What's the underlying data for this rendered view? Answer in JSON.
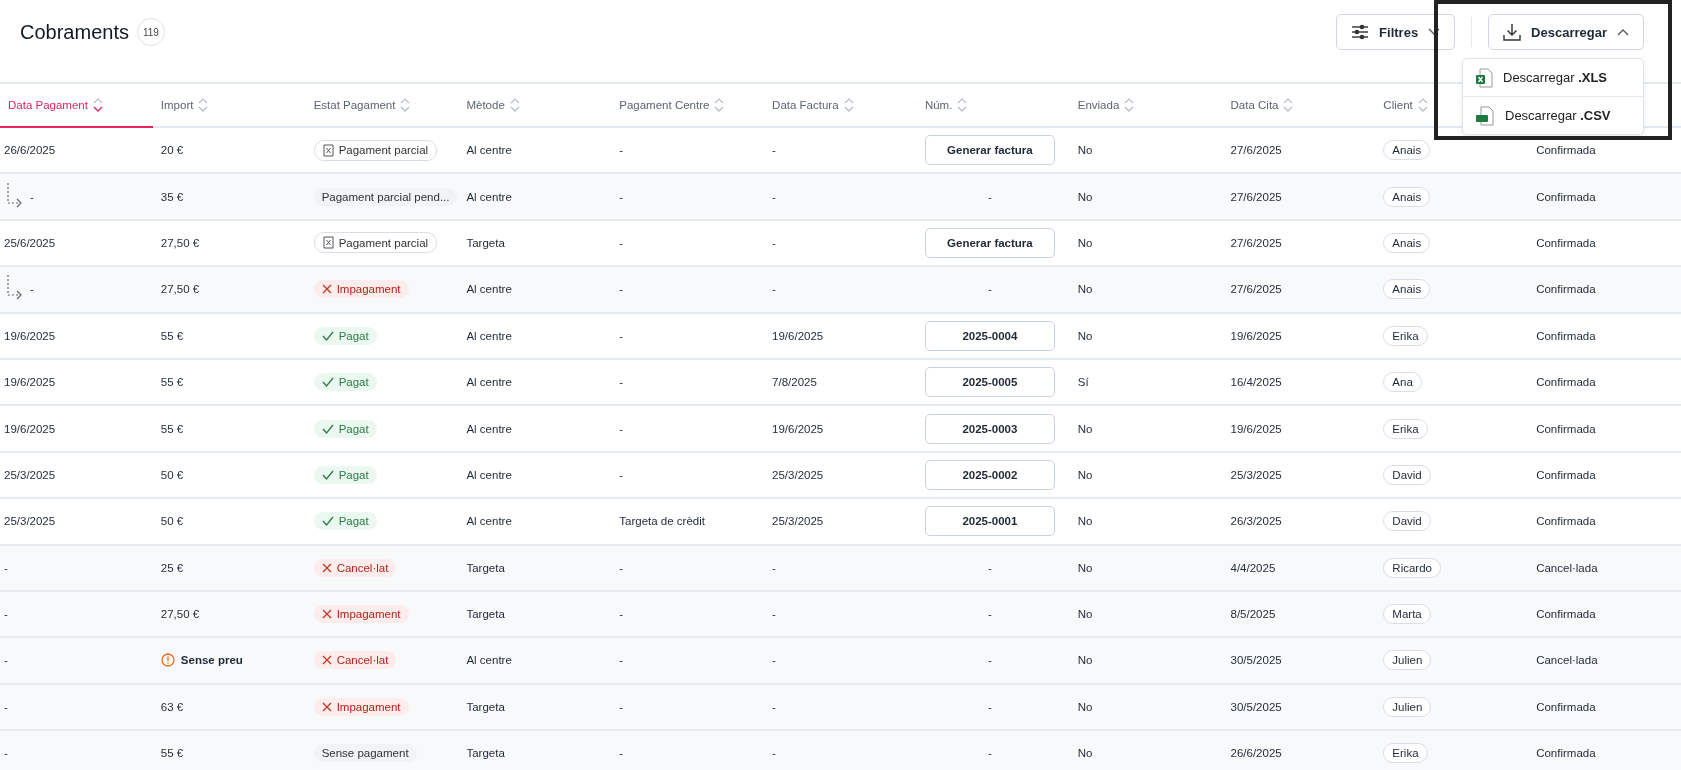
{
  "page": {
    "title": "Cobraments",
    "count": "119"
  },
  "toolbar": {
    "filters": {
      "label": "Filtres"
    },
    "download": {
      "label": "Descarregar",
      "expanded": true,
      "menu": [
        {
          "label": "Descarregar **.XLS**",
          "kind": "xls"
        },
        {
          "label": "Descarregar **.CSV**",
          "kind": "csv"
        }
      ]
    }
  },
  "table": {
    "columns": [
      {
        "label": "Data Pagament",
        "sorted": true
      },
      {
        "label": "Import",
        "sorted": false
      },
      {
        "label": "Estat Pagament",
        "sorted": false
      },
      {
        "label": "Mètode",
        "sorted": false
      },
      {
        "label": "Pagament Centre",
        "sorted": false
      },
      {
        "label": "Data Factura",
        "sorted": false
      },
      {
        "label": "Núm.",
        "sorted": false
      },
      {
        "label": "Enviada",
        "sorted": false
      },
      {
        "label": "Data Cita",
        "sorted": false
      },
      {
        "label": "Client",
        "sorted": false
      }
    ],
    "rows": [
      {
        "kind": "main",
        "date": "26/6/2025",
        "import": "20 €",
        "no_price": false,
        "status": {
          "label": "Pagament parcial",
          "kind": "partial"
        },
        "method": "Al centre",
        "centre": "-",
        "invoice_date": "-",
        "number": {
          "text": "Generar factura",
          "kind": "button"
        },
        "sent": "No",
        "appointment": "27/6/2025",
        "client": "Anais",
        "column_11": "Confirmada"
      },
      {
        "kind": "child",
        "date": "-",
        "import": "35 €",
        "no_price": false,
        "status": {
          "label": "Pagament parcial pend...",
          "kind": "plain"
        },
        "method": "Al centre",
        "centre": "-",
        "invoice_date": "-",
        "number": {
          "text": "-",
          "kind": "text"
        },
        "sent": "No",
        "appointment": "27/6/2025",
        "client": "Anais",
        "column_11": "Confirmada"
      },
      {
        "kind": "main",
        "date": "25/6/2025",
        "import": "27,50 €",
        "no_price": false,
        "status": {
          "label": "Pagament parcial",
          "kind": "partial"
        },
        "method": "Targeta",
        "centre": "-",
        "invoice_date": "-",
        "number": {
          "text": "Generar factura",
          "kind": "button"
        },
        "sent": "No",
        "appointment": "27/6/2025",
        "client": "Anais",
        "column_11": "Confirmada"
      },
      {
        "kind": "child",
        "date": "-",
        "import": "27,50 €",
        "no_price": false,
        "status": {
          "label": "Impagament",
          "kind": "error"
        },
        "method": "Al centre",
        "centre": "-",
        "invoice_date": "-",
        "number": {
          "text": "-",
          "kind": "text"
        },
        "sent": "No",
        "appointment": "27/6/2025",
        "client": "Anais",
        "column_11": "Confirmada"
      },
      {
        "kind": "main",
        "date": "19/6/2025",
        "import": "55 €",
        "no_price": false,
        "status": {
          "label": "Pagat",
          "kind": "success"
        },
        "method": "Al centre",
        "centre": "-",
        "invoice_date": "19/6/2025",
        "number": {
          "text": "2025-0004",
          "kind": "button"
        },
        "sent": "No",
        "appointment": "19/6/2025",
        "client": "Erika",
        "column_11": "Confirmada"
      },
      {
        "kind": "main",
        "date": "19/6/2025",
        "import": "55 €",
        "no_price": false,
        "status": {
          "label": "Pagat",
          "kind": "success"
        },
        "method": "Al centre",
        "centre": "-",
        "invoice_date": "7/8/2025",
        "number": {
          "text": "2025-0005",
          "kind": "button"
        },
        "sent": "Sí",
        "appointment": "16/4/2025",
        "client": "Ana",
        "column_11": "Confirmada"
      },
      {
        "kind": "main",
        "date": "19/6/2025",
        "import": "55 €",
        "no_price": false,
        "status": {
          "label": "Pagat",
          "kind": "success"
        },
        "method": "Al centre",
        "centre": "-",
        "invoice_date": "19/6/2025",
        "number": {
          "text": "2025-0003",
          "kind": "button"
        },
        "sent": "No",
        "appointment": "19/6/2025",
        "client": "Erika",
        "column_11": "Confirmada"
      },
      {
        "kind": "main",
        "date": "25/3/2025",
        "import": "50 €",
        "no_price": false,
        "status": {
          "label": "Pagat",
          "kind": "success"
        },
        "method": "Al centre",
        "centre": "-",
        "invoice_date": "25/3/2025",
        "number": {
          "text": "2025-0002",
          "kind": "button"
        },
        "sent": "No",
        "appointment": "25/3/2025",
        "client": "David",
        "column_11": "Confirmada"
      },
      {
        "kind": "main",
        "date": "25/3/2025",
        "import": "50 €",
        "no_price": false,
        "status": {
          "label": "Pagat",
          "kind": "success"
        },
        "method": "Al centre",
        "centre": "Targeta de crèdit",
        "invoice_date": "25/3/2025",
        "number": {
          "text": "2025-0001",
          "kind": "button"
        },
        "sent": "No",
        "appointment": "26/3/2025",
        "client": "David",
        "column_11": "Confirmada"
      },
      {
        "kind": "pending",
        "date": "-",
        "import": "25 €",
        "no_price": false,
        "status": {
          "label": "Cancel·lat",
          "kind": "error"
        },
        "method": "Targeta",
        "centre": "-",
        "invoice_date": "-",
        "number": {
          "text": "-",
          "kind": "text"
        },
        "sent": "No",
        "appointment": "4/4/2025",
        "client": "Ricardo",
        "column_11": "Cancel·lada"
      },
      {
        "kind": "pending",
        "date": "-",
        "import": "27,50 €",
        "no_price": false,
        "status": {
          "label": "Impagament",
          "kind": "error"
        },
        "method": "Targeta",
        "centre": "-",
        "invoice_date": "-",
        "number": {
          "text": "-",
          "kind": "text"
        },
        "sent": "No",
        "appointment": "8/5/2025",
        "client": "Marta",
        "column_11": "Confirmada"
      },
      {
        "kind": "pending",
        "date": "-",
        "import": "Sense preu",
        "no_price": true,
        "status": {
          "label": "Cancel·lat",
          "kind": "error"
        },
        "method": "Al centre",
        "centre": "-",
        "invoice_date": "-",
        "number": {
          "text": "-",
          "kind": "text"
        },
        "sent": "No",
        "appointment": "30/5/2025",
        "client": "Julien",
        "column_11": "Cancel·lada"
      },
      {
        "kind": "pending",
        "date": "-",
        "import": "63 €",
        "no_price": false,
        "status": {
          "label": "Impagament",
          "kind": "error"
        },
        "method": "Targeta",
        "centre": "-",
        "invoice_date": "-",
        "number": {
          "text": "-",
          "kind": "text"
        },
        "sent": "No",
        "appointment": "30/5/2025",
        "client": "Julien",
        "column_11": "Confirmada"
      },
      {
        "kind": "pending",
        "date": "-",
        "import": "55 €",
        "no_price": false,
        "status": {
          "label": "Sense pagament",
          "kind": "plain"
        },
        "method": "Targeta",
        "centre": "-",
        "invoice_date": "-",
        "number": {
          "text": "-",
          "kind": "text"
        },
        "sent": "No",
        "appointment": "26/6/2025",
        "client": "Erika",
        "column_11": "Confirmada"
      }
    ]
  }
}
